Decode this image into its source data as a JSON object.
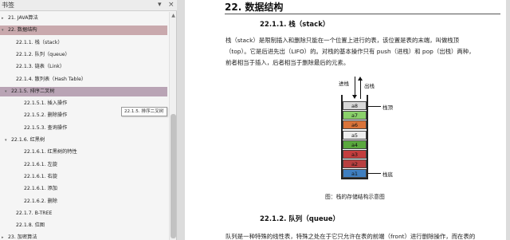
{
  "bookmarks_panel": {
    "title": "书签",
    "buttons": {
      "menu": "▾",
      "close": "×"
    },
    "tooltip": "22.1.5. 排序二叉树",
    "items": [
      {
        "label": "21. JAVA算法",
        "twisty": "▸"
      },
      {
        "label": "22. 数据结构",
        "twisty": "▾",
        "selected": true
      },
      {
        "label": "22.1.1. 栈（stack）",
        "twisty": ""
      },
      {
        "label": "22.1.2. 队列（queue）",
        "twisty": ""
      },
      {
        "label": "22.1.3. 链表（Link）",
        "twisty": ""
      },
      {
        "label": "22.1.4. 散列表（Hash Table）",
        "twisty": ""
      },
      {
        "label": "22.1.5. 排序二叉树",
        "twisty": "▾",
        "hover": true
      },
      {
        "label": "22.1.5.1. 插入操作",
        "twisty": ""
      },
      {
        "label": "22.1.5.2. 删除操作",
        "twisty": ""
      },
      {
        "label": "22.1.5.3. 查询操作",
        "twisty": ""
      },
      {
        "label": "22.1.6. 红黑树",
        "twisty": "▾"
      },
      {
        "label": "22.1.6.1. 红黑树的特性",
        "twisty": ""
      },
      {
        "label": "22.1.6.1. 左旋",
        "twisty": ""
      },
      {
        "label": "22.1.6.1. 右旋",
        "twisty": ""
      },
      {
        "label": "22.1.6.1. 添加",
        "twisty": ""
      },
      {
        "label": "22.1.6.2. 删除",
        "twisty": ""
      },
      {
        "label": "22.1.7. B-TREE",
        "twisty": ""
      },
      {
        "label": "22.1.8. 位图",
        "twisty": ""
      },
      {
        "label": "23. 加密算法",
        "twisty": "▸"
      }
    ]
  },
  "document": {
    "chapter_title": "22.  数据结构",
    "section_stack": "22.1.1.    栈（stack）",
    "stack_para": [
      "栈（stack）是限制插入和删除只能在一个位置上进行的表，该位置是表的末端，叫做栈顶",
      "（top）。它是后进先出（LIFO）的。对栈的基本操作只有 push（进栈）和 pop（出栈）两种，",
      "前者相当于插入，后者相当于删除最后的元素。"
    ],
    "figure": {
      "label_push": "进栈",
      "label_pop": "出栈",
      "label_top": "栈顶",
      "label_bottom": "栈底",
      "cells": [
        {
          "text": "a8",
          "color": "#d9d9d9"
        },
        {
          "text": "a7",
          "color": "#8ad06a"
        },
        {
          "text": "a6",
          "color": "#d9733a"
        },
        {
          "text": "a5",
          "color": "#eeeeee"
        },
        {
          "text": "a4",
          "color": "#5aa83e"
        },
        {
          "text": "a3",
          "color": "#c33e3e"
        },
        {
          "text": "a2",
          "color": "#b84040"
        },
        {
          "text": "a1",
          "color": "#3f7fc0"
        }
      ],
      "caption": "图：栈的存储结构示意图"
    },
    "section_queue": "22.1.2.    队列（queue）",
    "queue_para": "队列是一种特殊的线性表，特殊之处在于它只允许在表的前端（front）进行删除操作，而在表的"
  }
}
